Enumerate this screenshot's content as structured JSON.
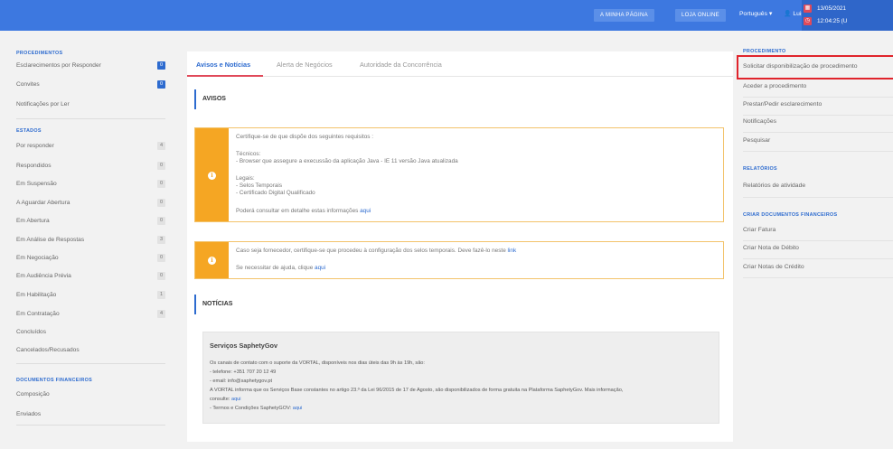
{
  "topbar": {
    "minha_pagina": "A MINHA PÁGINA",
    "loja_online": "LOJA ONLINE",
    "language": "Português ▾",
    "user": "Luis Roby ▾",
    "date": "13/05/2021",
    "time": "12:04:25 (U",
    "brand_color": "#3d78e0"
  },
  "sidebar": {
    "procedimentos_head": "PROCEDIMENTOS",
    "procedimentos": [
      {
        "label": "Esclarecimentos por Responder",
        "count": "0"
      },
      {
        "label": "Convites",
        "count": "0"
      },
      {
        "label": "Notificações por Ler",
        "count": ""
      }
    ],
    "estados_head": "ESTADOS",
    "estados": [
      {
        "label": "Por responder",
        "count": "4"
      },
      {
        "label": "Respondidos",
        "count": "0"
      },
      {
        "label": "Em Suspensão",
        "count": "0"
      },
      {
        "label": "A Aguardar Abertura",
        "count": "0"
      },
      {
        "label": "Em Abertura",
        "count": "0"
      },
      {
        "label": "Em Análise de Respostas",
        "count": "3"
      },
      {
        "label": "Em Negociação",
        "count": "0"
      },
      {
        "label": "Em Audiência Prévia",
        "count": "0"
      },
      {
        "label": "Em Habilitação",
        "count": "1"
      },
      {
        "label": "Em Contratação",
        "count": "4"
      },
      {
        "label": "Concluídos",
        "count": ""
      },
      {
        "label": "Cancelados/Recusados",
        "count": ""
      }
    ],
    "docs_head": "DOCUMENTOS FINANCEIROS",
    "docs": [
      {
        "label": "Composição"
      },
      {
        "label": "Enviados"
      }
    ]
  },
  "content": {
    "tabs": [
      "Avisos e Notícias",
      "Alerta de Negócios",
      "Autoridade da Concorrência"
    ],
    "avisos_title": "AVISOS",
    "alert1": {
      "l1": "Certifique-se de que dispõe dos seguintes requisitos :",
      "l2": "Técnicos:",
      "l3": "- Browser que assegure a execussão da aplicação Java - IE 11 versão Java atualizada",
      "l4": "Legais:",
      "l5": "- Selos Temporais",
      "l6": "- Certificado Digital Qualificado",
      "l7": "Poderá consultar em detalhe estas informações",
      "l7_link": "aqui"
    },
    "alert2": {
      "l1": "Caso seja fornecedor, certifique-se que procedeu à configuração dos selos temporais. Deve fazê-lo neste",
      "l1_link": "link",
      "l2": "Se necessitar de ajuda, clique",
      "l2_link": "aqui"
    },
    "noticias_title": "NOTÍCIAS",
    "news": {
      "title": "Serviços SaphetyGov",
      "l1": "Os canais de contato com o suporte da VORTAL, disponíveis nos dias úteis das 9h às 19h, são:",
      "l2": "- telefone: +351 707 20 12 49",
      "l3": "- email: info@saphetygov.pt",
      "l4": "A VORTAL informa que os Serviços Base constantes no artigo 23.º da Lei 96/2015 de 17 de Agosto, são disponibilizados de forma gratuita na Plataforma SaphetyGov. Mais informação,",
      "l5": "consulte:",
      "l5_link": "aqui",
      "l6": "- Termos e Condições SaphetyGOV:",
      "l6_link": "aqui"
    }
  },
  "rpanel": {
    "procedimento_head": "PROCEDIMENTO",
    "procedimento": [
      "Solicitar disponibilização de procedimento",
      "Aceder a procedimento",
      "Prestar/Pedir esclarecimento",
      "Notificações",
      "Pesquisar"
    ],
    "relatorios_head": "RELATÓRIOS",
    "relatorios": [
      "Relatórios de atividade"
    ],
    "financeiros_head": "CRIAR DOCUMENTOS FINANCEIROS",
    "financeiros": [
      "Criar Fatura",
      "Criar Nota de Débito",
      "Criar Notas de Crédito"
    ]
  }
}
